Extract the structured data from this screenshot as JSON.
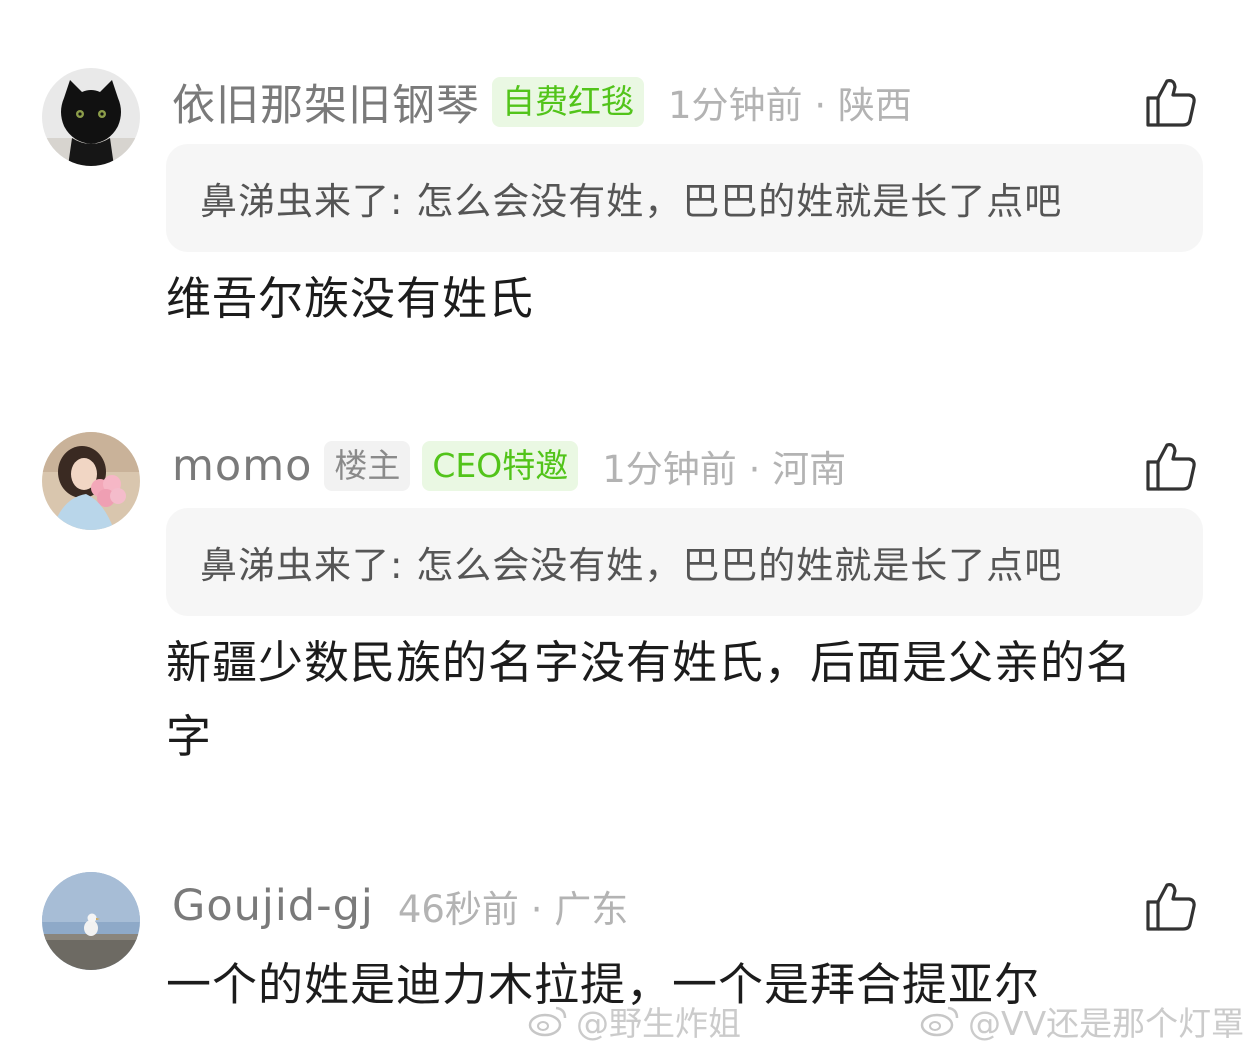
{
  "comments": [
    {
      "username": "依旧那架旧钢琴",
      "badges": [
        "自费红毯"
      ],
      "time": "1分钟前",
      "location": "陕西",
      "quote": "鼻涕虫来了: 怎么会没有姓，巴巴的姓就是长了点吧",
      "text": "维吾尔族没有姓氏",
      "avatar_icon": "black-cat-avatar"
    },
    {
      "username": "momo",
      "owner_tag": "楼主",
      "badges": [
        "CEO特邀"
      ],
      "time": "1分钟前",
      "location": "河南",
      "quote": "鼻涕虫来了: 怎么会没有姓，巴巴的姓就是长了点吧",
      "text": "新疆少数民族的名字没有姓氏，后面是父亲的名字",
      "avatar_icon": "girl-with-flowers-avatar"
    },
    {
      "username": "Goujid-gj",
      "time": "46秒前",
      "location": "广东",
      "text": "一个的姓是迪力木拉提，一个是拜合提亚尔",
      "avatar_icon": "seagull-avatar"
    }
  ],
  "separator": "·",
  "like_icon": "thumbs-up-icon",
  "watermarks": [
    "@野生炸姐",
    "@VV还是那个灯罩"
  ],
  "colors": {
    "username": "#7a7a7a",
    "badge_green_text": "#52c41a",
    "badge_green_bg": "#eaf8e3",
    "badge_gray_bg": "#f2f2f2",
    "meta": "#b3b3b3",
    "quote_bg": "#f6f6f6",
    "body_text": "#1c1c1c"
  }
}
